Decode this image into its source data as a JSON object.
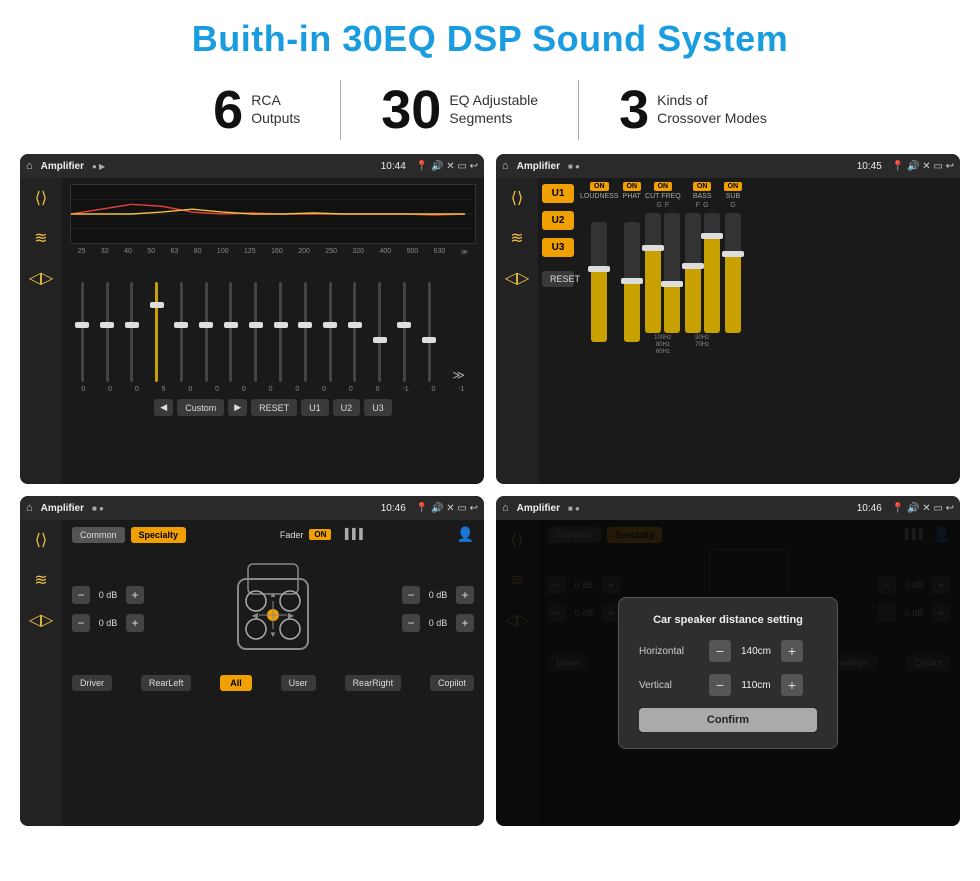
{
  "page": {
    "title": "Buith-in 30EQ DSP Sound System"
  },
  "stats": [
    {
      "number": "6",
      "label": "RCA\nOutputs"
    },
    {
      "number": "30",
      "label": "EQ Adjustable\nSegments"
    },
    {
      "number": "3",
      "label": "Kinds of\nCrossover Modes"
    }
  ],
  "screens": [
    {
      "id": "screen1",
      "title": "Amplifier",
      "time": "10:44",
      "desc": "EQ Sliders"
    },
    {
      "id": "screen2",
      "title": "Amplifier",
      "time": "10:45",
      "desc": "Crossover"
    },
    {
      "id": "screen3",
      "title": "Amplifier",
      "time": "10:46",
      "desc": "Fader"
    },
    {
      "id": "screen4",
      "title": "Amplifier",
      "time": "10:46",
      "desc": "Distance Setting"
    }
  ],
  "eq": {
    "frequencies": [
      "25",
      "32",
      "40",
      "50",
      "63",
      "80",
      "100",
      "125",
      "160",
      "200",
      "250",
      "320",
      "400",
      "500",
      "630"
    ],
    "values": [
      "0",
      "0",
      "0",
      "5",
      "0",
      "0",
      "0",
      "0",
      "0",
      "0",
      "0",
      "0",
      "-1",
      "0",
      "-1"
    ],
    "buttons": [
      "Custom",
      "RESET",
      "U1",
      "U2",
      "U3"
    ]
  },
  "crossover": {
    "u_buttons": [
      "U1",
      "U2",
      "U3"
    ],
    "channels": [
      "LOUDNESS",
      "PHAT",
      "CUT FREQ",
      "BASS",
      "SUB"
    ],
    "reset_label": "RESET"
  },
  "fader": {
    "common_label": "Common",
    "specialty_label": "Specialty",
    "fader_label": "Fader",
    "on_label": "ON",
    "db_values": [
      "0 dB",
      "0 dB",
      "0 dB",
      "0 dB"
    ],
    "buttons": [
      "Driver",
      "RearLeft",
      "All",
      "User",
      "RearRight",
      "Copilot"
    ]
  },
  "dialog": {
    "title": "Car speaker distance setting",
    "horizontal_label": "Horizontal",
    "horizontal_value": "140cm",
    "vertical_label": "Vertical",
    "vertical_value": "110cm",
    "confirm_label": "Confirm"
  }
}
